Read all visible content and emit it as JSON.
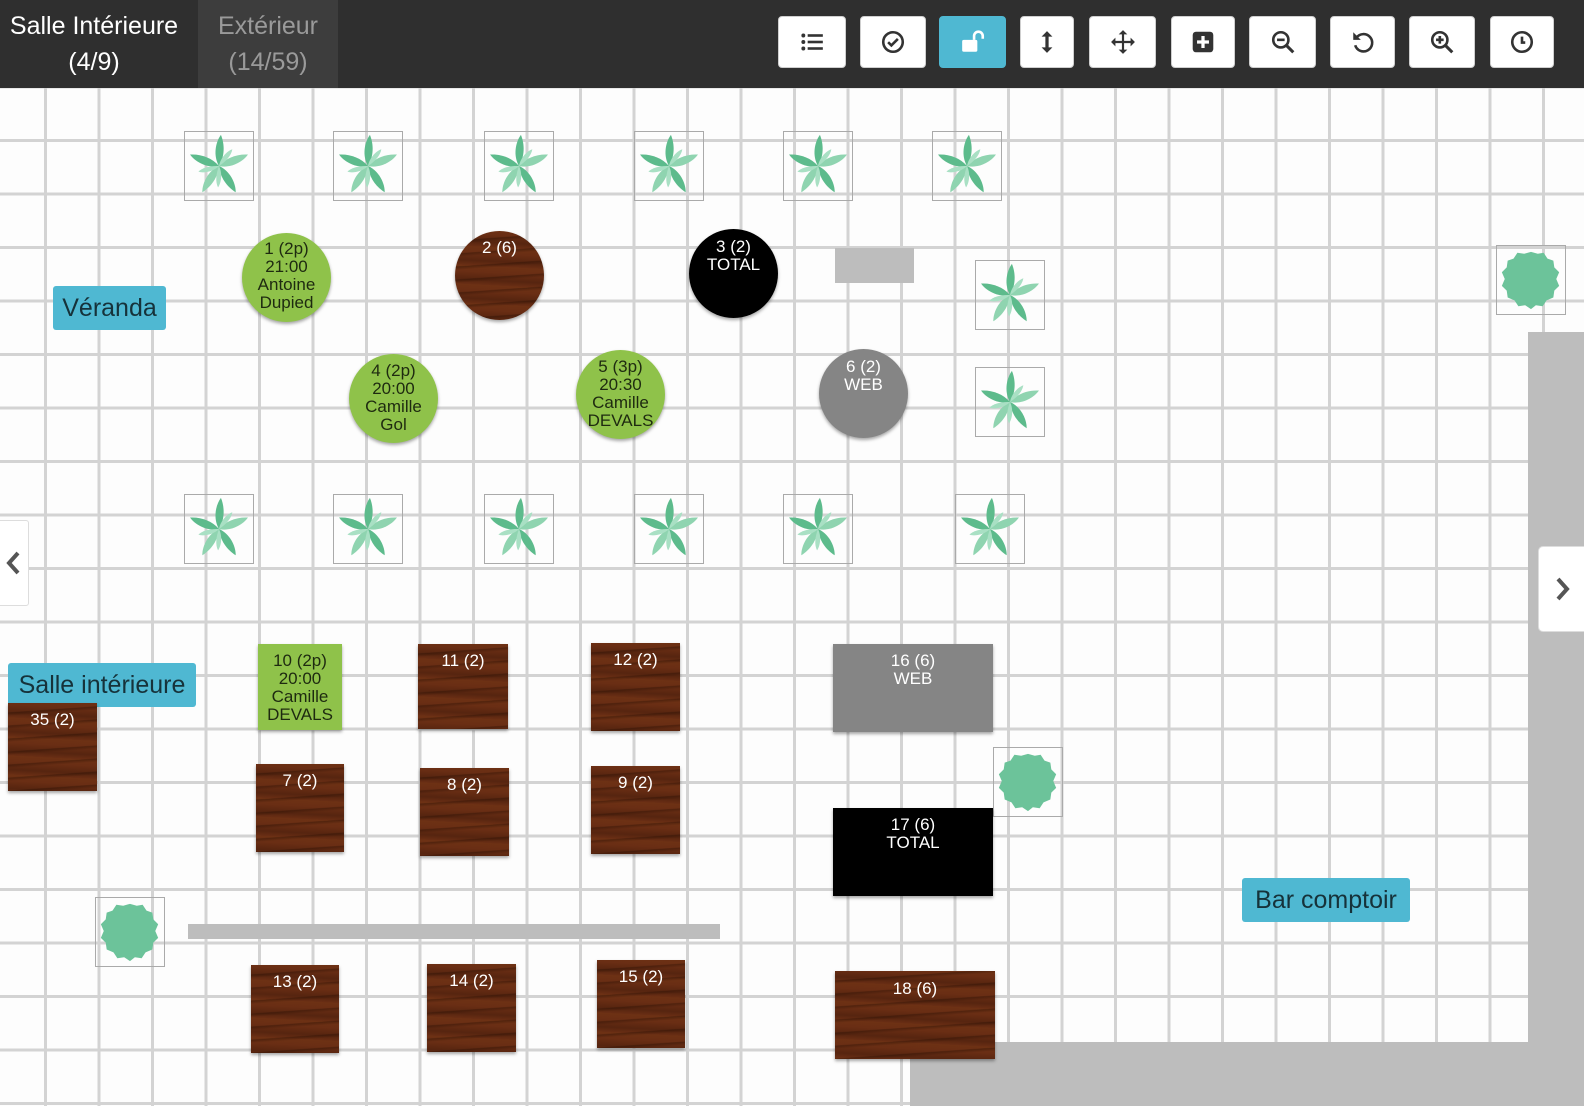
{
  "rooms": [
    {
      "name": "Salle Intérieure",
      "count": "(4/9)",
      "active": true
    },
    {
      "name": "Extérieur",
      "count": "(14/59)",
      "active": false
    }
  ],
  "toolbar": [
    {
      "icon": "list-icon",
      "active": false
    },
    {
      "icon": "check-circle-icon",
      "active": false
    },
    {
      "icon": "unlock-icon",
      "active": true
    },
    {
      "icon": "vertical-arrows-icon",
      "active": false
    },
    {
      "icon": "move-icon",
      "active": false
    },
    {
      "icon": "plus-square-icon",
      "active": false
    },
    {
      "icon": "zoom-out-icon",
      "active": false
    },
    {
      "icon": "undo-icon",
      "active": false
    },
    {
      "icon": "zoom-in-icon",
      "active": false
    },
    {
      "icon": "clock-icon",
      "active": false
    }
  ],
  "zones": {
    "veranda": "Véranda",
    "salle": "Salle intérieure",
    "bar": "Bar comptoir"
  },
  "tables": {
    "t1": [
      "1 (2p)",
      "21:00",
      "Antoine",
      "Dupied"
    ],
    "t2": [
      "2 (6)"
    ],
    "t3": [
      "3 (2)",
      "TOTAL"
    ],
    "t4": [
      "4 (2p)",
      "20:00",
      "Camille",
      "Gol"
    ],
    "t5": [
      "5 (3p)",
      "20:30",
      "Camille",
      "DEVALS"
    ],
    "t6": [
      "6 (2)",
      "WEB"
    ],
    "t7": [
      "7 (2)"
    ],
    "t8": [
      "8 (2)"
    ],
    "t9": [
      "9 (2)"
    ],
    "t10": [
      "10 (2p)",
      "20:00",
      "Camille",
      "DEVALS"
    ],
    "t11": [
      "11 (2)"
    ],
    "t12": [
      "12 (2)"
    ],
    "t13": [
      "13 (2)"
    ],
    "t14": [
      "14 (2)"
    ],
    "t15": [
      "15 (2)"
    ],
    "t16": [
      "16 (6)",
      "WEB"
    ],
    "t17": [
      "17 (6)",
      "TOTAL"
    ],
    "t18": [
      "18 (6)"
    ],
    "t35": [
      "35 (2)"
    ]
  },
  "colors": {
    "accent": "#4fb8d2",
    "occupied": "#8fc24a",
    "wood": "#6a2e14",
    "paid": "#000000",
    "web": "#858585",
    "plant": "#6cc39a"
  },
  "icons": {
    "plant": "leaf-plant-icon",
    "round_plant": "round-bush-icon",
    "prev": "chevron-left-icon",
    "next": "chevron-right-icon"
  }
}
